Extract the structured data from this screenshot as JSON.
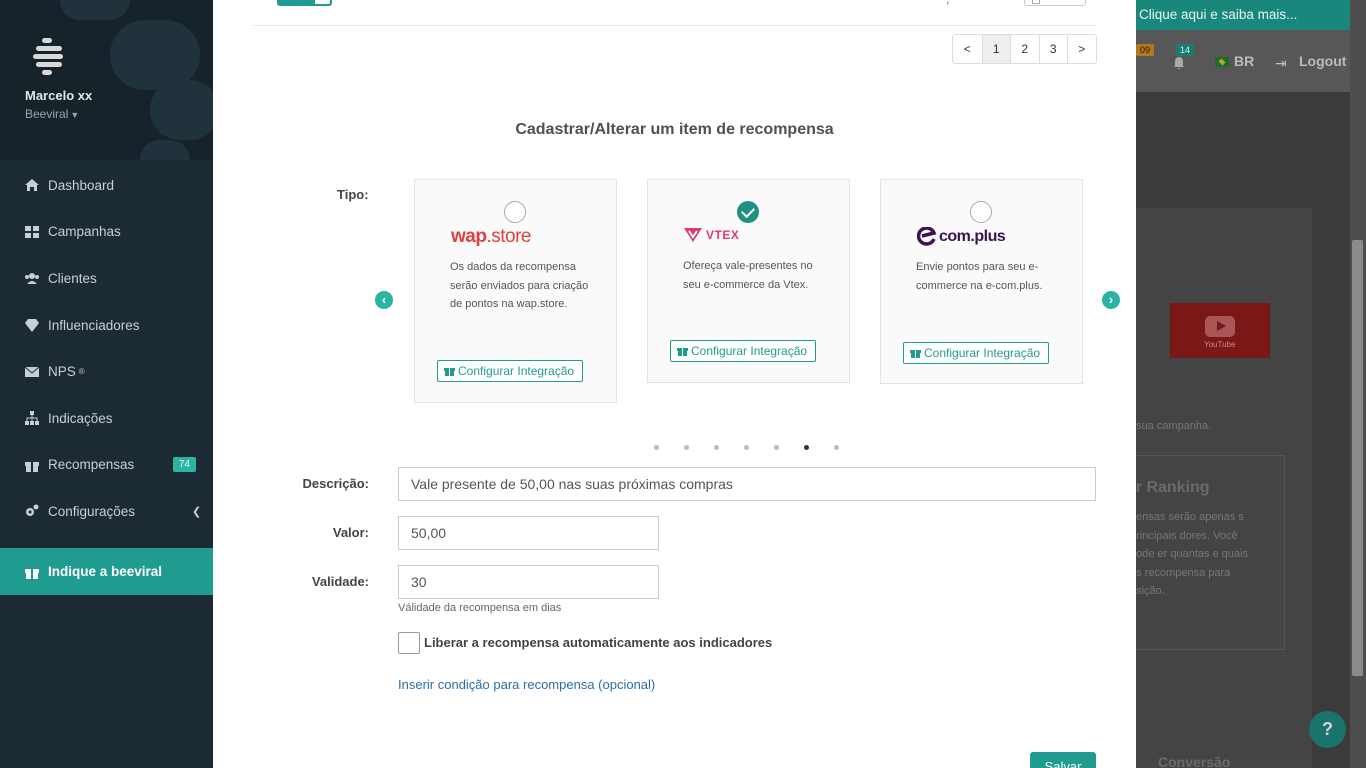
{
  "sidebar": {
    "user_name": "Marcelo xx",
    "org_name": "Beeviral",
    "items": [
      {
        "label": "Dashboard",
        "icon": "home-icon"
      },
      {
        "label": "Campanhas",
        "icon": "grid-icon"
      },
      {
        "label": "Clientes",
        "icon": "users-icon"
      },
      {
        "label": "Influenciadores",
        "icon": "diamond-icon"
      },
      {
        "label": "NPS",
        "sup": "®",
        "icon": "envelope-icon"
      },
      {
        "label": "Indicações",
        "icon": "sitemap-icon"
      },
      {
        "label": "Recompensas",
        "badge": "74",
        "icon": "gift-icon"
      },
      {
        "label": "Configurações",
        "icon": "cogs-icon"
      }
    ],
    "cta": "Indique a beeviral"
  },
  "topbar": {
    "banner": "Clique aqui e saiba mais...",
    "badge_a": "09",
    "badge_b": "14",
    "lang": "BR",
    "logout": "Logout"
  },
  "background": {
    "youtube_label": "YouTube",
    "campaign_text": "sua campanha.",
    "ranking_title": "or Ranking",
    "ranking_text": "pensas serão apenas s principais dores. Você pode er quantas e quais as recompensa para osição.",
    "conversion_label": "Conversão",
    "help_label": "?"
  },
  "modal": {
    "pagination": [
      "<",
      "1",
      "2",
      "3",
      ">"
    ],
    "pagination_active": "1",
    "title": "Cadastrar/Alterar um item de recompensa",
    "tipo_label": "Tipo:",
    "cards": [
      {
        "logo": "wap.store",
        "description": "Os dados da recompensa serão enviados para criação de pontos na wap.store.",
        "button": "Configurar Integração",
        "selected": false
      },
      {
        "logo": "VTEX",
        "description": "Ofereça vale-presentes no seu e-commerce da Vtex.",
        "button": "Configurar Integração",
        "selected": true
      },
      {
        "logo": "e-com.plus",
        "description": "Envie pontos para seu e-commerce na e-com.plus.",
        "button": "Configurar Integração",
        "selected": false
      }
    ],
    "carousel_dots": 7,
    "carousel_active_dot": 6,
    "form": {
      "descricao_label": "Descrição:",
      "descricao_value": "Vale presente de 50,00 nas suas próximas compras",
      "valor_label": "Valor:",
      "valor_value": "50,00",
      "validade_label": "Validade:",
      "validade_value": "30",
      "validade_help": "Válidade da recompensa em dias",
      "auto_release_label": "Liberar a recompensa automaticamente aos indicadores",
      "auto_release_checked": false,
      "condition_link": "Inserir condição para recompensa (opcional)",
      "save_button": "Salvar"
    }
  },
  "colors": {
    "accent": "#1f9c8f",
    "sidebar_bg": "#1c2b33",
    "link": "#2a6fa8"
  }
}
